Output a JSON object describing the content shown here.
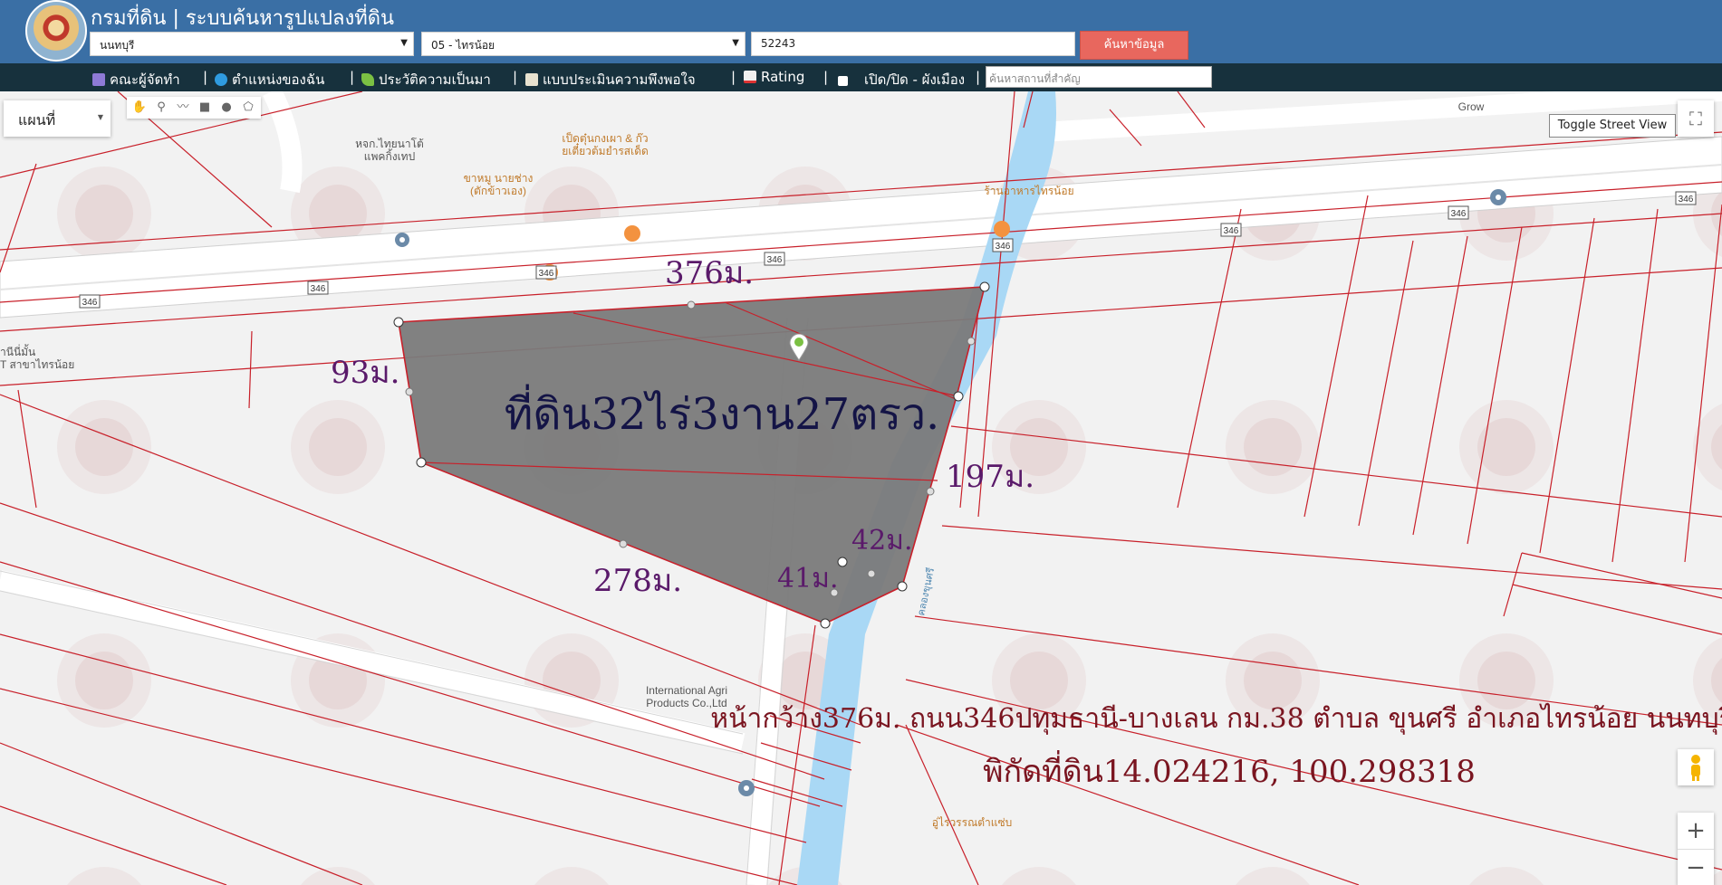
{
  "header": {
    "title": "กรมที่ดิน | ระบบค้นหารูปแปลงที่ดิน",
    "province": "นนทบุรี",
    "district": "05 - ไทรน้อย",
    "parcel_no": "52243",
    "search_button": "ค้นหาข้อมูล"
  },
  "nav": {
    "items": [
      {
        "label": "คณะผู้จัดทำ",
        "icon": "team-icon"
      },
      {
        "label": "ตำแหน่งของฉัน",
        "icon": "globe-icon"
      },
      {
        "label": "ประวัติความเป็นมา",
        "icon": "plant-icon"
      },
      {
        "label": "แบบประเมินความพึงพอใจ",
        "icon": "form-icon"
      },
      {
        "label": "Rating",
        "icon": "chart-icon"
      },
      {
        "label": "เปิด/ปิด - ผังเมือง",
        "icon": "checkbox-icon"
      }
    ],
    "search_placeholder": "ค้นหาสถานที่สำคัญ"
  },
  "map": {
    "maptype_label": "แผนที่",
    "street_view_button": "Toggle Street View",
    "road_number": "346",
    "places": {
      "school": [
        "หจก.ไทยนาโต้",
        "แพคกิ้งเทป"
      ],
      "restaurant1": [
        "เป็ดตุ๋นกงเผา & ก๊ว",
        "ยเตี๋ยวต้มยำรสเด็ด"
      ],
      "restaurant2": [
        "ขาหมู นายช่าง",
        "(ตักข้าวเอง)"
      ],
      "restaurant3": [
        "ร้านอาหารไทรน้อย"
      ],
      "grow": [
        "Grow"
      ],
      "bank": [
        "านีนี่มั้น",
        "T สาขาไทรน้อย"
      ],
      "agri": [
        "International Agri",
        "Products Co.,Ltd"
      ],
      "restaurant4": [
        "อู่ไรวรรณตำแซ่บ"
      ],
      "canal": [
        "คลองขุนศรี"
      ]
    },
    "measurements": {
      "top": "376ม.",
      "left": "93ม.",
      "right": "197ม.",
      "bottom": "278ม.",
      "small_a": "42ม.",
      "small_b": "41ม."
    },
    "area_label": "ที่ดิน32ไร่3งาน27ตรว.",
    "info_line1": "หน้ากว้าง376ม. ถนน346ปทุมธานี-บางเลน กม.38 ตำบล ขุนศรี อำเภอไทรน้อย นนทบุรี",
    "info_line2": "พิกัดที่ดิน14.024216, 100.298318",
    "colors": {
      "parcel_fill": "#7a7a7a",
      "boundary": "#c8202a",
      "canal": "#a9d8f5",
      "header_bg": "#3a6fa5",
      "nav_bg": "#17313d",
      "search_btn": "#e8675e"
    }
  }
}
